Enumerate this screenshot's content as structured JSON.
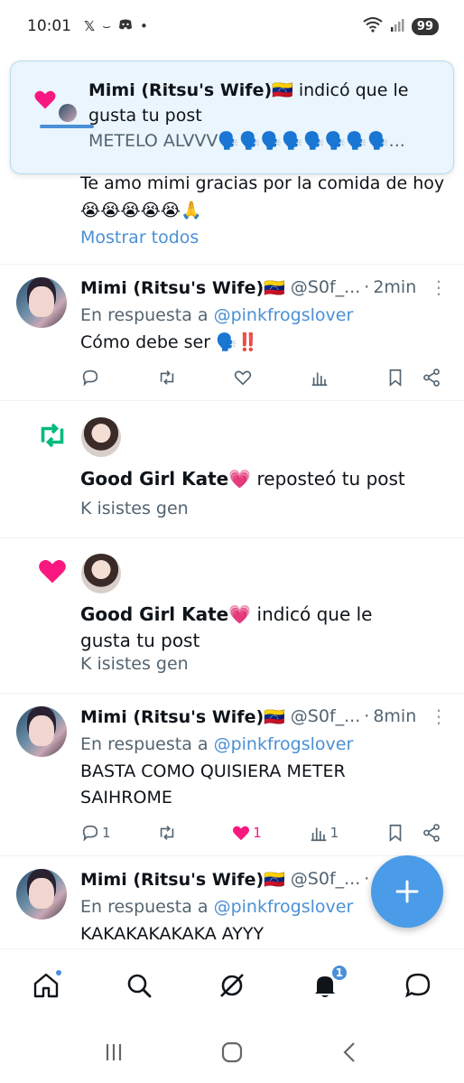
{
  "status_bar": {
    "time": "10:01",
    "battery": "99",
    "icons": [
      "x-icon",
      "amazon-icon",
      "discord-icon",
      "dot-icon",
      "wifi-icon",
      "signal-icon"
    ]
  },
  "toast": {
    "name": "Mimi (Ritsu's Wife)🇻🇪",
    "action": " indicó que le gusta tu post",
    "preview": "METELO ALVVV🗣️🗣️🗣️🗣️🗣️🗣️🗣️🗣️..."
  },
  "partial_tweet": {
    "text": "Te amo mimi gracias por la comida de hoy",
    "emojis": "😭😭😭😭😭🙏",
    "show_all": "Mostrar todos"
  },
  "tweets": [
    {
      "name": "Mimi (Ritsu's Wife)🇻🇪",
      "handle": "@S0f_...",
      "time": "2min",
      "reply_prefix": "En respuesta a ",
      "reply_to": "@pinkfrogslover",
      "text": "Cómo debe ser 🗣️‼️",
      "replies": "",
      "retweets": "",
      "likes": "",
      "views": ""
    },
    {
      "name": "Mimi (Ritsu's Wife)🇻🇪",
      "handle": "@S0f_...",
      "time": "8min",
      "reply_prefix": "En respuesta a ",
      "reply_to": "@pinkfrogslover",
      "text": "BASTA COMO QUISIERA METER SAIHROME",
      "replies": "1",
      "retweets": "",
      "likes": "1",
      "views": "1"
    },
    {
      "name": "Mimi (Ritsu's Wife)🇻🇪",
      "handle": "@S0f_...",
      "time": "",
      "reply_prefix": "En respuesta a ",
      "reply_to": "@pinkfrogslover",
      "text": "KAKAKAKAKAKA AYYY"
    }
  ],
  "notifications": [
    {
      "type": "repost",
      "name": "Good Girl Kate💗",
      "action": " reposteó tu post",
      "subtext": "K isistes gen"
    },
    {
      "type": "like",
      "name": "Good Girl Kate💗",
      "action": " indicó que le gusta tu post",
      "subtext": "K isistes gen"
    }
  ],
  "bottom_nav": {
    "items": [
      "home-icon",
      "search-icon",
      "grok-icon",
      "notifications-icon",
      "messages-icon"
    ],
    "notifications_badge": "1"
  },
  "colors": {
    "accent": "#4a90d6",
    "like": "#f91880",
    "repost": "#00ba7c",
    "secondary_text": "#536471"
  }
}
